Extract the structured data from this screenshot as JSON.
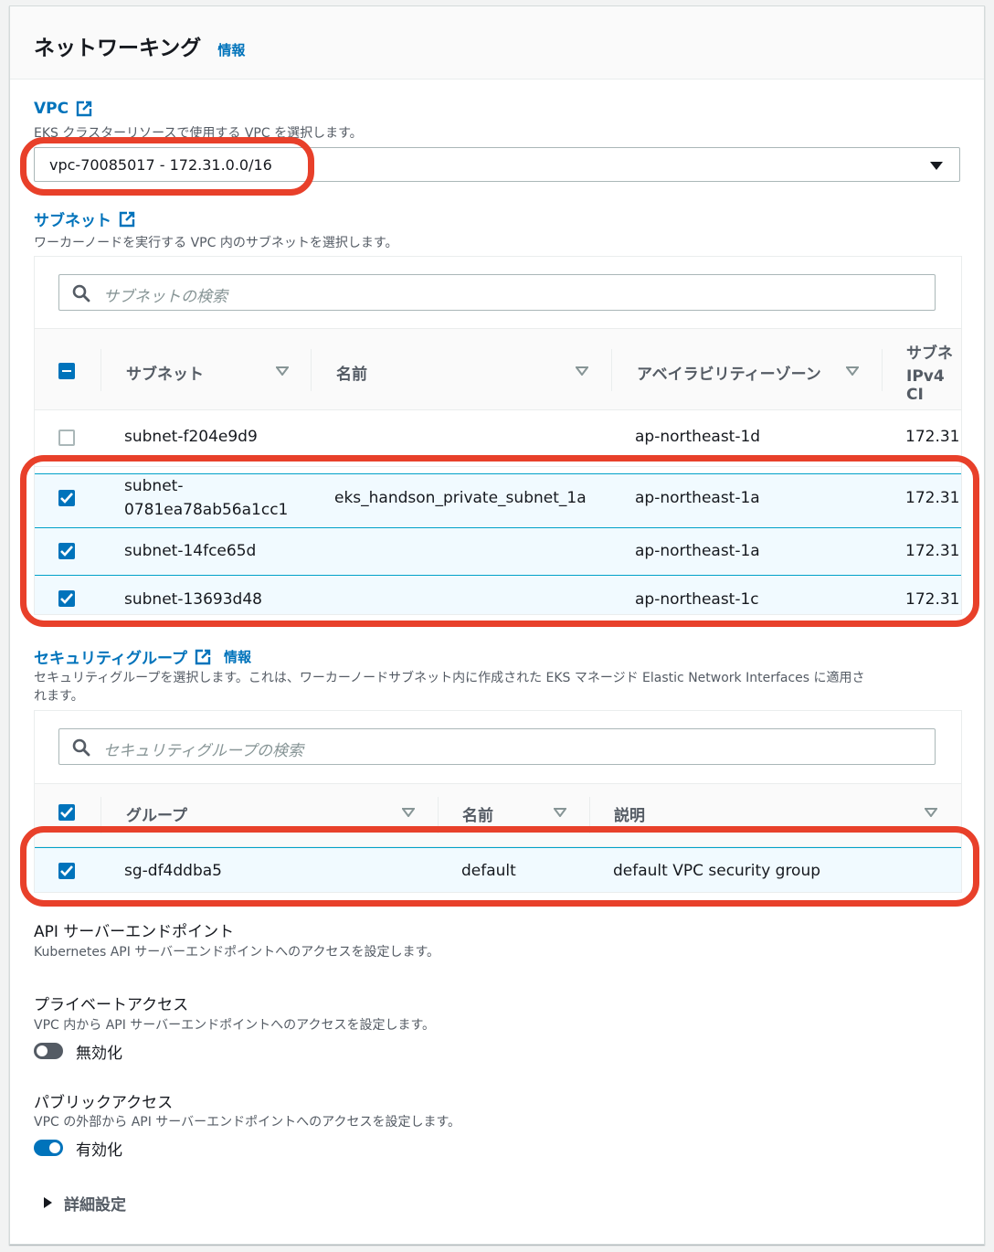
{
  "panel": {
    "title": "ネットワーキング",
    "info": "情報"
  },
  "vpc": {
    "label": "VPC",
    "description": "EKS クラスターリソースで使用する VPC を選択します。",
    "selected": "vpc-70085017 - 172.31.0.0/16"
  },
  "subnets": {
    "label": "サブネット",
    "description": "ワーカーノードを実行する VPC 内のサブネットを選択します。",
    "search_placeholder": "サブネットの検索",
    "columns": {
      "subnet": "サブネット",
      "name": "名前",
      "az": "アベイラビリティーゾーン",
      "cidr_line1": "サブネ",
      "cidr_line2": "IPv4 CI"
    },
    "rows": [
      {
        "subnet": "subnet-f204e9d9",
        "name": "",
        "az": "ap-northeast-1d",
        "cidr": "172.31",
        "checked": false
      },
      {
        "subnet_line1": "subnet-",
        "subnet_line2": "0781ea78ab56a1cc1",
        "name": "eks_handson_private_subnet_1a",
        "az": "ap-northeast-1a",
        "cidr": "172.31",
        "checked": true
      },
      {
        "subnet": "subnet-14fce65d",
        "name": "",
        "az": "ap-northeast-1a",
        "cidr": "172.31",
        "checked": true
      },
      {
        "subnet": "subnet-13693d48",
        "name": "",
        "az": "ap-northeast-1c",
        "cidr": "172.31",
        "checked": true
      }
    ]
  },
  "security_groups": {
    "label": "セキュリティグループ",
    "info": "情報",
    "description_line1": "セキュリティグループを選択します。これは、ワーカーノードサブネット内に作成された EKS マネージド Elastic Network Interfaces に適用さ",
    "description_line2": "れます。",
    "search_placeholder": "セキュリティグループの検索",
    "columns": {
      "group": "グループ",
      "name": "名前",
      "description": "説明"
    },
    "rows": [
      {
        "group": "sg-df4ddba5",
        "name": "default",
        "description": "default VPC security group",
        "checked": true
      }
    ]
  },
  "endpoint": {
    "title": "API サーバーエンドポイント",
    "description": "Kubernetes API サーバーエンドポイントへのアクセスを設定します。"
  },
  "private_access": {
    "title": "プライベートアクセス",
    "description": "VPC 内から API サーバーエンドポイントへのアクセスを設定します。",
    "toggle_label": "無効化",
    "enabled": false
  },
  "public_access": {
    "title": "パブリックアクセス",
    "description": "VPC の外部から API サーバーエンドポイントへのアクセスを設定します。",
    "toggle_label": "有効化",
    "enabled": true
  },
  "advanced": {
    "label": "詳細設定"
  },
  "colors": {
    "link": "#0073bb",
    "highlight": "#e8402a",
    "selected_row": "#f1faff"
  }
}
